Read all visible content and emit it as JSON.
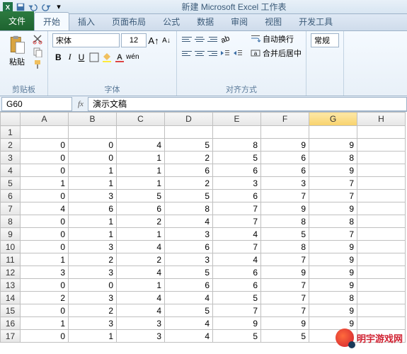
{
  "title": "新建 Microsoft Excel 工作表",
  "tabs": {
    "file": "文件",
    "home": "开始",
    "insert": "插入",
    "layout": "页面布局",
    "formulas": "公式",
    "data": "数据",
    "review": "审阅",
    "view": "视图",
    "dev": "开发工具"
  },
  "ribbon": {
    "clipboard": {
      "label": "剪贴板",
      "paste": "粘贴"
    },
    "font": {
      "label": "字体",
      "name": "宋体",
      "size": "12",
      "bold": "B",
      "italic": "I",
      "underline": "U"
    },
    "align": {
      "label": "对齐方式",
      "wrap": "自动换行",
      "merge": "合并后居中"
    },
    "number": {
      "general": "常规"
    }
  },
  "namebox": "G60",
  "fx": "fx",
  "formula": "演示文稿",
  "columns": [
    "A",
    "B",
    "C",
    "D",
    "E",
    "F",
    "G",
    "H"
  ],
  "selected_col": 6,
  "rows": [
    {
      "n": 1,
      "c": [
        "",
        "",
        "",
        "",
        "",
        "",
        "",
        ""
      ]
    },
    {
      "n": 2,
      "c": [
        "0",
        "0",
        "4",
        "5",
        "8",
        "9",
        "9",
        ""
      ]
    },
    {
      "n": 3,
      "c": [
        "0",
        "0",
        "1",
        "2",
        "5",
        "6",
        "8",
        ""
      ]
    },
    {
      "n": 4,
      "c": [
        "0",
        "1",
        "1",
        "6",
        "6",
        "6",
        "9",
        ""
      ]
    },
    {
      "n": 5,
      "c": [
        "1",
        "1",
        "1",
        "2",
        "3",
        "3",
        "7",
        ""
      ]
    },
    {
      "n": 6,
      "c": [
        "0",
        "3",
        "5",
        "5",
        "6",
        "7",
        "7",
        ""
      ]
    },
    {
      "n": 7,
      "c": [
        "4",
        "6",
        "6",
        "8",
        "7",
        "9",
        "9",
        ""
      ]
    },
    {
      "n": 8,
      "c": [
        "0",
        "1",
        "2",
        "4",
        "7",
        "8",
        "8",
        ""
      ]
    },
    {
      "n": 9,
      "c": [
        "0",
        "1",
        "1",
        "3",
        "4",
        "5",
        "7",
        ""
      ]
    },
    {
      "n": 10,
      "c": [
        "0",
        "3",
        "4",
        "6",
        "7",
        "8",
        "9",
        ""
      ]
    },
    {
      "n": 11,
      "c": [
        "1",
        "2",
        "2",
        "3",
        "4",
        "7",
        "9",
        ""
      ]
    },
    {
      "n": 12,
      "c": [
        "3",
        "3",
        "4",
        "5",
        "6",
        "9",
        "9",
        ""
      ]
    },
    {
      "n": 13,
      "c": [
        "0",
        "0",
        "1",
        "6",
        "6",
        "7",
        "9",
        ""
      ]
    },
    {
      "n": 14,
      "c": [
        "2",
        "3",
        "4",
        "4",
        "5",
        "7",
        "8",
        ""
      ]
    },
    {
      "n": 15,
      "c": [
        "0",
        "2",
        "4",
        "5",
        "7",
        "7",
        "9",
        ""
      ]
    },
    {
      "n": 16,
      "c": [
        "1",
        "3",
        "3",
        "4",
        "9",
        "9",
        "9",
        ""
      ]
    },
    {
      "n": 17,
      "c": [
        "0",
        "1",
        "3",
        "4",
        "5",
        "5",
        "9",
        ""
      ]
    }
  ],
  "watermark": "明宇游戏网"
}
